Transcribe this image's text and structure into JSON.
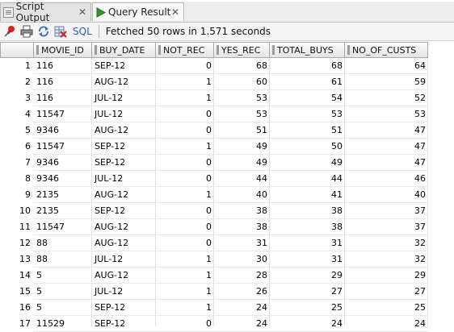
{
  "tabs": [
    {
      "label": "Script Output",
      "close": "✕"
    },
    {
      "label": "Query Result",
      "close": "✕"
    }
  ],
  "toolbar": {
    "sql_label": "SQL",
    "status": "Fetched 50 rows in 1.571 seconds"
  },
  "columns": [
    "MOVIE_ID",
    "BUY_DATE",
    "NOT_REC",
    "YES_REC",
    "TOTAL_BUYS",
    "NO_OF_CUSTS"
  ],
  "rows": [
    [
      "1",
      "116",
      "SEP-12",
      "0",
      "68",
      "68",
      "64"
    ],
    [
      "2",
      "116",
      "AUG-12",
      "1",
      "60",
      "61",
      "59"
    ],
    [
      "3",
      "116",
      "JUL-12",
      "1",
      "53",
      "54",
      "52"
    ],
    [
      "4",
      "11547",
      "JUL-12",
      "0",
      "53",
      "53",
      "53"
    ],
    [
      "5",
      "9346",
      "AUG-12",
      "0",
      "51",
      "51",
      "47"
    ],
    [
      "6",
      "11547",
      "SEP-12",
      "1",
      "49",
      "50",
      "47"
    ],
    [
      "7",
      "9346",
      "SEP-12",
      "0",
      "49",
      "49",
      "47"
    ],
    [
      "8",
      "9346",
      "JUL-12",
      "0",
      "44",
      "44",
      "46"
    ],
    [
      "9",
      "2135",
      "AUG-12",
      "1",
      "40",
      "41",
      "40"
    ],
    [
      "10",
      "2135",
      "SEP-12",
      "0",
      "38",
      "38",
      "37"
    ],
    [
      "11",
      "11547",
      "AUG-12",
      "0",
      "38",
      "38",
      "37"
    ],
    [
      "12",
      "88",
      "AUG-12",
      "0",
      "31",
      "31",
      "32"
    ],
    [
      "13",
      "88",
      "JUL-12",
      "1",
      "30",
      "31",
      "32"
    ],
    [
      "14",
      "5",
      "AUG-12",
      "1",
      "28",
      "29",
      "29"
    ],
    [
      "15",
      "5",
      "JUL-12",
      "1",
      "26",
      "27",
      "27"
    ],
    [
      "16",
      "5",
      "SEP-12",
      "1",
      "24",
      "25",
      "25"
    ],
    [
      "17",
      "11529",
      "SEP-12",
      "0",
      "24",
      "24",
      "24"
    ]
  ],
  "icons": {
    "pin": "pin-icon",
    "print": "print-icon",
    "refresh": "refresh-icon",
    "clear": "clear-icon",
    "play": "play-icon",
    "script": "script-icon"
  },
  "colors": {
    "play_green": "#2d9a2d",
    "pin_red": "#d42424",
    "sql_blue": "#2a5fb5"
  }
}
